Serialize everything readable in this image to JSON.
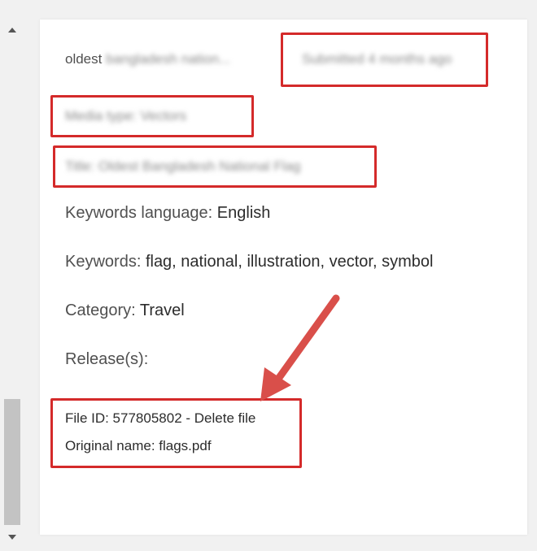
{
  "header_row": {
    "prefix": "oldest",
    "blurred_name": "bangladesh nation...",
    "submitted": "Submitted 4 months ago"
  },
  "media_type": "Media type: Vectors",
  "title_line": "Title: Oldest Bangladesh National Flag",
  "keywords_language": {
    "label": "Keywords language:",
    "value": "English"
  },
  "keywords": {
    "label": "Keywords:",
    "value": "flag, national, illustration, vector, symbol"
  },
  "category": {
    "label": "Category:",
    "value": "Travel"
  },
  "releases": {
    "label": "Release(s):"
  },
  "file_id": {
    "label": "File ID: 577805802 - ",
    "delete": "Delete file"
  },
  "original_name": "Original name: flags.pdf",
  "colors": {
    "highlight": "#d42a2a",
    "arrow": "#d94f4a"
  }
}
